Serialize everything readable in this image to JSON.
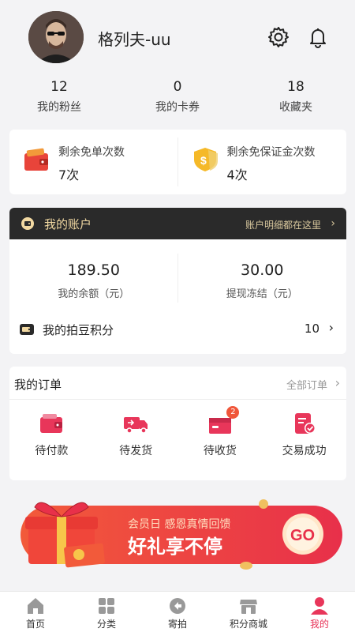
{
  "profile": {
    "username": "格列夫-uu"
  },
  "stats": [
    {
      "value": "12",
      "label": "我的粉丝"
    },
    {
      "value": "0",
      "label": "我的卡券"
    },
    {
      "value": "18",
      "label": "收藏夹"
    }
  ],
  "free": [
    {
      "label": "剩余免单次数",
      "value": "7次",
      "icon": "wallet-icon"
    },
    {
      "label": "剩余免保证金次数",
      "value": "4次",
      "icon": "shield-coin-icon"
    }
  ],
  "account": {
    "title": "我的账户",
    "detail_link": "账户明细都在这里",
    "balance_value": "189.50",
    "balance_label": "我的余额（元）",
    "frozen_value": "30.00",
    "frozen_label": "提现冻结（元）",
    "points_label": "我的拍豆积分",
    "points_value": "10"
  },
  "orders": {
    "title": "我的订单",
    "all_label": "全部订单",
    "items": [
      {
        "label": "待付款",
        "icon": "wallet-icon"
      },
      {
        "label": "待发货",
        "icon": "truck-icon"
      },
      {
        "label": "待收货",
        "icon": "box-icon",
        "badge": "2"
      },
      {
        "label": "交易成功",
        "icon": "check-doc-icon"
      }
    ]
  },
  "banner": {
    "top_text": "会员日 感恩真情回馈",
    "main_text": "好礼享不停",
    "go_text": "GO"
  },
  "tabs": [
    {
      "label": "首页",
      "icon": "home-icon"
    },
    {
      "label": "分类",
      "icon": "grid-icon"
    },
    {
      "label": "寄拍",
      "icon": "send-icon"
    },
    {
      "label": "积分商城",
      "icon": "store-icon"
    },
    {
      "label": "我的",
      "icon": "user-icon",
      "active": true
    }
  ],
  "colors": {
    "accent": "#e8365a",
    "gold": "#f2d9a2",
    "dark": "#2a2a2a"
  }
}
